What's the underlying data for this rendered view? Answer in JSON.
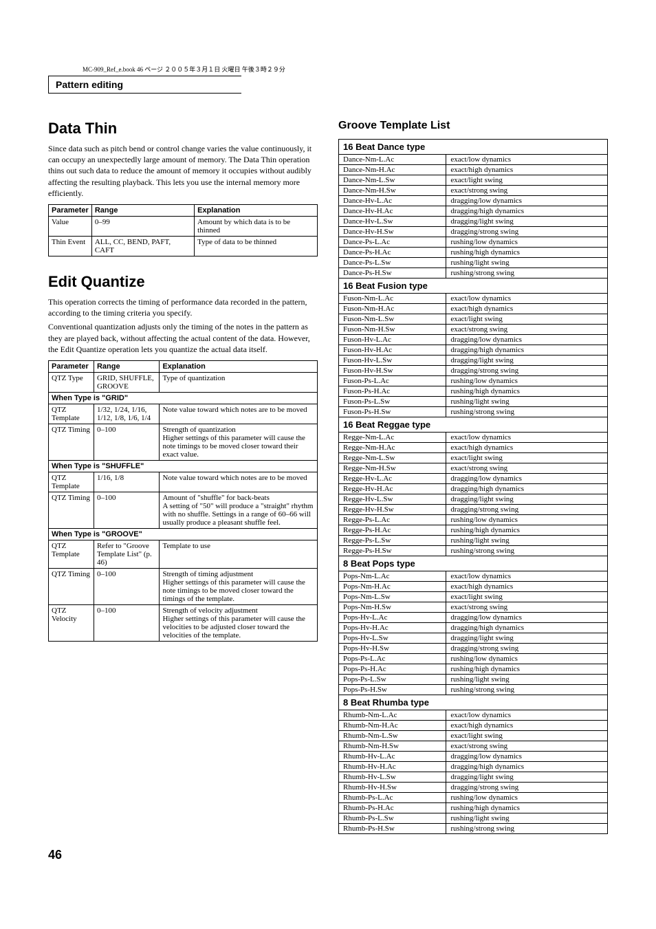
{
  "pre_header": "MC-909_Ref_e.book  46 ページ  ２００５年３月１日  火曜日  午後３時２９分",
  "section_header": "Pattern editing",
  "page_number": "46",
  "left": {
    "data_thin": {
      "title": "Data Thin",
      "intro": "Since data such as pitch bend or control change varies the value continuously, it can occupy an unexpectedly large amount of memory. The Data Thin operation thins out such data to reduce the amount of memory it occupies without audibly affecting the resulting playback. This lets you use the internal memory more efficiently.",
      "headers": [
        "Parameter",
        "Range",
        "Explanation"
      ],
      "rows": [
        [
          "Value",
          "0–99",
          "Amount by which data is to be thinned"
        ],
        [
          "Thin Event",
          "ALL, CC, BEND, PAFT, CAFT",
          "Type of data to be thinned"
        ]
      ]
    },
    "edit_quantize": {
      "title": "Edit Quantize",
      "intro1": "This operation corrects the timing of performance data recorded in the pattern, according to the timing criteria you specify.",
      "intro2": "Conventional quantization adjusts only the timing of the notes in the pattern as they are played back, without affecting the actual content of the data. However, the Edit Quantize operation lets you quantize the actual data itself.",
      "headers": [
        "Parameter",
        "Range",
        "Explanation"
      ],
      "row_type": [
        "QTZ Type",
        "GRID, SHUFFLE, GROOVE",
        "Type of quantization"
      ],
      "sub_grid": "When Type is \"GRID\"",
      "grid_rows": [
        [
          "QTZ Template",
          "1/32, 1/24, 1/16, 1/12, 1/8, 1/6, 1/4",
          "Note value toward which notes are to be moved"
        ],
        [
          "QTZ Timing",
          "0–100",
          "Strength of quantization\nHigher settings of this parameter will cause the note timings to be moved closer toward their exact value."
        ]
      ],
      "sub_shuffle": "When Type is \"SHUFFLE\"",
      "shuffle_rows": [
        [
          "QTZ Template",
          "1/16, 1/8",
          "Note value toward which notes are to be moved"
        ],
        [
          "QTZ Timing",
          "0–100",
          "Amount of \"shuffle\" for back-beats\nA setting of \"50\" will produce a \"straight\" rhythm with no shuffle. Settings in a range of 60–66 will usually produce a pleasant shuffle feel."
        ]
      ],
      "sub_groove": "When Type is \"GROOVE\"",
      "groove_rows": [
        [
          "QTZ Template",
          "Refer to \"Groove Template List\" (p. 46)",
          "Template to use"
        ],
        [
          "QTZ Timing",
          "0–100",
          "Strength of timing adjustment\nHigher settings of this parameter will cause the note timings to be moved closer toward the timings of the template."
        ],
        [
          "QTZ Velocity",
          "0–100",
          "Strength of velocity adjustment\nHigher settings of this parameter will cause the velocities to be adjusted closer toward the velocities of the template."
        ]
      ]
    }
  },
  "right": {
    "title": "Groove Template List",
    "groups": [
      {
        "header": "16 Beat Dance type",
        "rows": [
          [
            "Dance-Nm-L.Ac",
            "exact/low dynamics"
          ],
          [
            "Dance-Nm-H.Ac",
            "exact/high dynamics"
          ],
          [
            "Dance-Nm-L.Sw",
            "exact/light swing"
          ],
          [
            "Dance-Nm-H.Sw",
            "exact/strong swing"
          ],
          [
            "Dance-Hv-L.Ac",
            "dragging/low dynamics"
          ],
          [
            "Dance-Hv-H.Ac",
            "dragging/high dynamics"
          ],
          [
            "Dance-Hv-L.Sw",
            "dragging/light swing"
          ],
          [
            "Dance-Hv-H.Sw",
            "dragging/strong swing"
          ],
          [
            "Dance-Ps-L.Ac",
            "rushing/low dynamics"
          ],
          [
            "Dance-Ps-H.Ac",
            "rushing/high dynamics"
          ],
          [
            "Dance-Ps-L.Sw",
            "rushing/light swing"
          ],
          [
            "Dance-Ps-H.Sw",
            "rushing/strong swing"
          ]
        ]
      },
      {
        "header": "16 Beat Fusion type",
        "rows": [
          [
            "Fuson-Nm-L.Ac",
            "exact/low dynamics"
          ],
          [
            "Fuson-Nm-H.Ac",
            "exact/high dynamics"
          ],
          [
            "Fuson-Nm-L.Sw",
            "exact/light swing"
          ],
          [
            "Fuson-Nm-H.Sw",
            "exact/strong swing"
          ],
          [
            "Fuson-Hv-L.Ac",
            "dragging/low dynamics"
          ],
          [
            "Fuson-Hv-H.Ac",
            "dragging/high dynamics"
          ],
          [
            "Fuson-Hv-L.Sw",
            "dragging/light swing"
          ],
          [
            "Fuson-Hv-H.Sw",
            "dragging/strong swing"
          ],
          [
            "Fuson-Ps-L.Ac",
            "rushing/low dynamics"
          ],
          [
            "Fuson-Ps-H.Ac",
            "rushing/high dynamics"
          ],
          [
            "Fuson-Ps-L.Sw",
            "rushing/light swing"
          ],
          [
            "Fuson-Ps-H.Sw",
            "rushing/strong swing"
          ]
        ]
      },
      {
        "header": "16 Beat Reggae type",
        "rows": [
          [
            "Regge-Nm-L.Ac",
            "exact/low dynamics"
          ],
          [
            "Regge-Nm-H.Ac",
            "exact/high dynamics"
          ],
          [
            "Regge-Nm-L.Sw",
            "exact/light swing"
          ],
          [
            "Regge-Nm-H.Sw",
            "exact/strong swing"
          ],
          [
            "Regge-Hv-L.Ac",
            "dragging/low dynamics"
          ],
          [
            "Regge-Hv-H.Ac",
            "dragging/high dynamics"
          ],
          [
            "Regge-Hv-L.Sw",
            "dragging/light swing"
          ],
          [
            "Regge-Hv-H.Sw",
            "dragging/strong swing"
          ],
          [
            "Regge-Ps-L.Ac",
            "rushing/low dynamics"
          ],
          [
            "Regge-Ps-H.Ac",
            "rushing/high dynamics"
          ],
          [
            "Regge-Ps-L.Sw",
            "rushing/light swing"
          ],
          [
            "Regge-Ps-H.Sw",
            "rushing/strong swing"
          ]
        ]
      },
      {
        "header": "8 Beat Pops type",
        "rows": [
          [
            "Pops-Nm-L.Ac",
            "exact/low dynamics"
          ],
          [
            "Pops-Nm-H.Ac",
            "exact/high dynamics"
          ],
          [
            "Pops-Nm-L.Sw",
            "exact/light swing"
          ],
          [
            "Pops-Nm-H.Sw",
            "exact/strong swing"
          ],
          [
            "Pops-Hv-L.Ac",
            "dragging/low dynamics"
          ],
          [
            "Pops-Hv-H.Ac",
            "dragging/high dynamics"
          ],
          [
            "Pops-Hv-L.Sw",
            "dragging/light swing"
          ],
          [
            "Pops-Hv-H.Sw",
            "dragging/strong swing"
          ],
          [
            "Pops-Ps-L.Ac",
            "rushing/low dynamics"
          ],
          [
            "Pops-Ps-H.Ac",
            "rushing/high dynamics"
          ],
          [
            "Pops-Ps-L.Sw",
            "rushing/light swing"
          ],
          [
            "Pops-Ps-H.Sw",
            "rushing/strong swing"
          ]
        ]
      },
      {
        "header": "8 Beat Rhumba type",
        "rows": [
          [
            "Rhumb-Nm-L.Ac",
            "exact/low dynamics"
          ],
          [
            "Rhumb-Nm-H.Ac",
            "exact/high dynamics"
          ],
          [
            "Rhumb-Nm-L.Sw",
            "exact/light swing"
          ],
          [
            "Rhumb-Nm-H.Sw",
            "exact/strong swing"
          ],
          [
            "Rhumb-Hv-L.Ac",
            "dragging/low dynamics"
          ],
          [
            "Rhumb-Hv-H.Ac",
            "dragging/high dynamics"
          ],
          [
            "Rhumb-Hv-L.Sw",
            "dragging/light swing"
          ],
          [
            "Rhumb-Hv-H.Sw",
            "dragging/strong swing"
          ],
          [
            "Rhumb-Ps-L.Ac",
            "rushing/low dynamics"
          ],
          [
            "Rhumb-Ps-H.Ac",
            "rushing/high dynamics"
          ],
          [
            "Rhumb-Ps-L.Sw",
            "rushing/light swing"
          ],
          [
            "Rhumb-Ps-H.Sw",
            "rushing/strong swing"
          ]
        ]
      }
    ]
  }
}
